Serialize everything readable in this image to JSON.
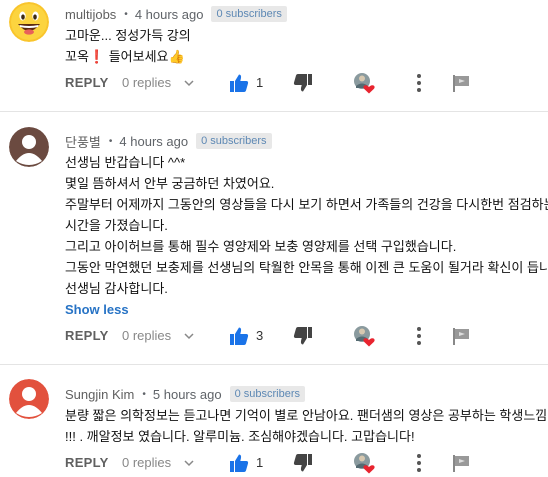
{
  "comments": [
    {
      "author": "multijobs",
      "time": "4 hours ago",
      "badge": "0 subscribers",
      "lines": [
        "고마운... 정성가득 강의",
        "꼬옥❗ 들어보세요👍"
      ],
      "show_less": "",
      "reply_label": "REPLY",
      "replies_label": "0 replies",
      "likes": "1"
    },
    {
      "author": "단풍별",
      "time": "4 hours ago",
      "badge": "0 subscribers",
      "lines": [
        "선생님 반갑습니다 ^^*",
        "몇일 뜸하셔서 안부 궁금하던 차였어요.",
        "주말부터 어제까지 그동안의 영상들을 다시 보기 하면서 가족들의 건강을 다시한번 점검하는",
        "시간을 가졌습니다.",
        "그리고 아이허브를 통해 필수 영양제와 보충 영양제를  선택 구입했습니다.",
        "그동안 막연했던 보충제를 선생님의 탁월한 안목을 통해 이젠 큰 도움이 될거라 확신이 듭니다.",
        "선생님 감사합니다."
      ],
      "show_less": "Show less",
      "reply_label": "REPLY",
      "replies_label": "0 replies",
      "likes": "3"
    },
    {
      "author": "Sungjin Kim",
      "time": "5 hours ago",
      "badge": "0 subscribers",
      "lines": [
        "분량 짧은 의학정보는 듣고나면 기억이 별로 안남아요.  팬더샘의 영상은 공부하는  학생느낌.",
        "!!! .  깨알정보 였습니다. 알루미늄. 조심해야겠습니다. 고맙습니다!"
      ],
      "show_less": "",
      "reply_label": "REPLY",
      "replies_label": "0 replies",
      "likes": "1"
    }
  ],
  "colors": {
    "like_blue": "#1a73e8",
    "heart_red": "#e8242f",
    "link_blue": "#2773c5",
    "badge_bg": "#e8e8e8"
  },
  "icons": {
    "like": "thumbs-up-icon",
    "dislike": "thumbs-down-icon",
    "heart": "creator-heart-icon",
    "more": "more-vertical-icon",
    "flag": "flag-icon",
    "chevron": "chevron-down-icon"
  }
}
